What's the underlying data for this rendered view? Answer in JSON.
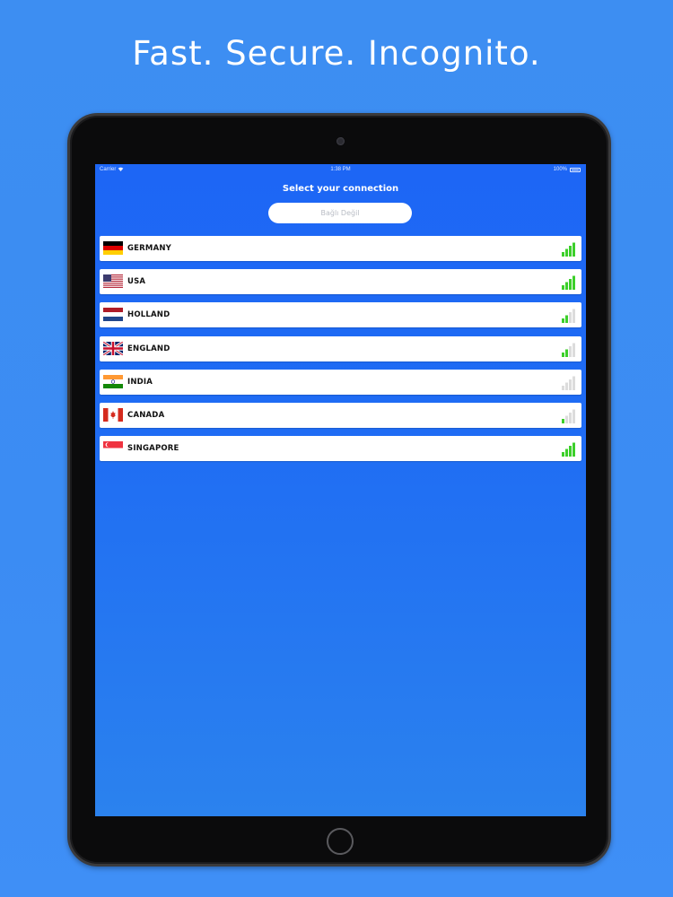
{
  "headline": "Fast. Secure. Incognito.",
  "statusbar": {
    "carrier": "Carrier",
    "time": "1:38 PM",
    "battery": "100%"
  },
  "screen": {
    "title": "Select your connection",
    "status_pill": "Bağlı Değil"
  },
  "colors": {
    "background": "#3d8ef2",
    "screen": "#1f6cf4",
    "signal_on": "#3ccf2a",
    "signal_off": "#dcdcdc"
  },
  "servers": [
    {
      "name": "GERMANY",
      "flag": "germany-flag-icon",
      "signal_bars": 4
    },
    {
      "name": "USA",
      "flag": "usa-flag-icon",
      "signal_bars": 4
    },
    {
      "name": "HOLLAND",
      "flag": "netherlands-flag-icon",
      "signal_bars": 2
    },
    {
      "name": "ENGLAND",
      "flag": "uk-flag-icon",
      "signal_bars": 2
    },
    {
      "name": "INDIA",
      "flag": "india-flag-icon",
      "signal_bars": 0
    },
    {
      "name": "CANADA",
      "flag": "canada-flag-icon",
      "signal_bars": 1
    },
    {
      "name": "SINGAPORE",
      "flag": "singapore-flag-icon",
      "signal_bars": 4
    }
  ]
}
